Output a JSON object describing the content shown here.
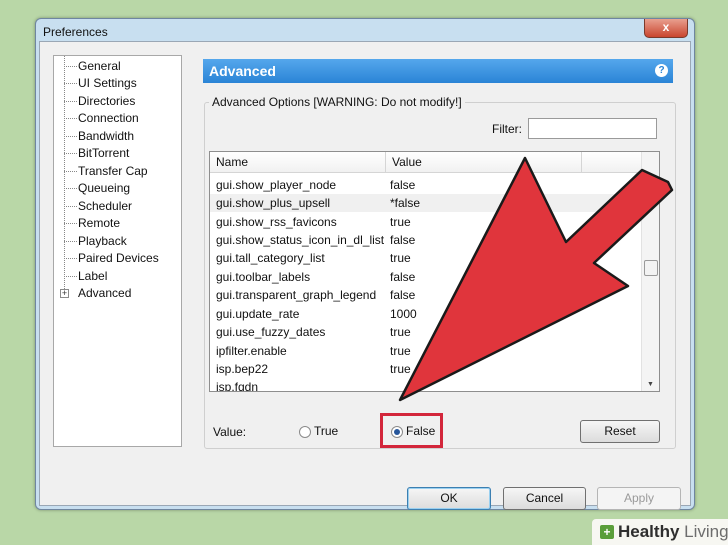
{
  "window": {
    "title": "Preferences",
    "close_glyph": "x"
  },
  "sidebar": {
    "items": [
      {
        "label": "General"
      },
      {
        "label": "UI Settings"
      },
      {
        "label": "Directories"
      },
      {
        "label": "Connection"
      },
      {
        "label": "Bandwidth"
      },
      {
        "label": "BitTorrent"
      },
      {
        "label": "Transfer Cap"
      },
      {
        "label": "Queueing"
      },
      {
        "label": "Scheduler"
      },
      {
        "label": "Remote"
      },
      {
        "label": "Playback"
      },
      {
        "label": "Paired Devices"
      },
      {
        "label": "Label"
      },
      {
        "label": "Advanced",
        "selected": true
      }
    ]
  },
  "panel": {
    "title": "Advanced",
    "help_icon": "question-icon",
    "group_title": "Advanced Options [WARNING: Do not modify!]",
    "filter_label": "Filter:",
    "filter_value": "",
    "columns": {
      "name": "Name",
      "value": "Value"
    },
    "rows": [
      {
        "name": "gui.show_player_node",
        "value": "false"
      },
      {
        "name": "gui.show_plus_upsell",
        "value": "*false"
      },
      {
        "name": "gui.show_rss_favicons",
        "value": "true"
      },
      {
        "name": "gui.show_status_icon_in_dl_list",
        "value": "false"
      },
      {
        "name": "gui.tall_category_list",
        "value": "true"
      },
      {
        "name": "gui.toolbar_labels",
        "value": "false"
      },
      {
        "name": "gui.transparent_graph_legend",
        "value": "false"
      },
      {
        "name": "gui.update_rate",
        "value": "1000"
      },
      {
        "name": "gui.use_fuzzy_dates",
        "value": "true"
      },
      {
        "name": "ipfilter.enable",
        "value": "true"
      },
      {
        "name": "isp.bep22",
        "value": "true"
      },
      {
        "name": "isp.fqdn",
        "value": ""
      }
    ],
    "value_label": "Value:",
    "radio_true": "True",
    "radio_false": "False",
    "selected_radio": "False",
    "reset_label": "Reset"
  },
  "footer": {
    "ok": "OK",
    "cancel": "Cancel",
    "apply": "Apply"
  },
  "watermark": {
    "brand_bold": "Healthy",
    "brand_light": "Living",
    "icon": "plus-icon"
  },
  "colors": {
    "header": "#2a84d6",
    "highlight": "#d3263b",
    "background": "#b9d7a7"
  }
}
